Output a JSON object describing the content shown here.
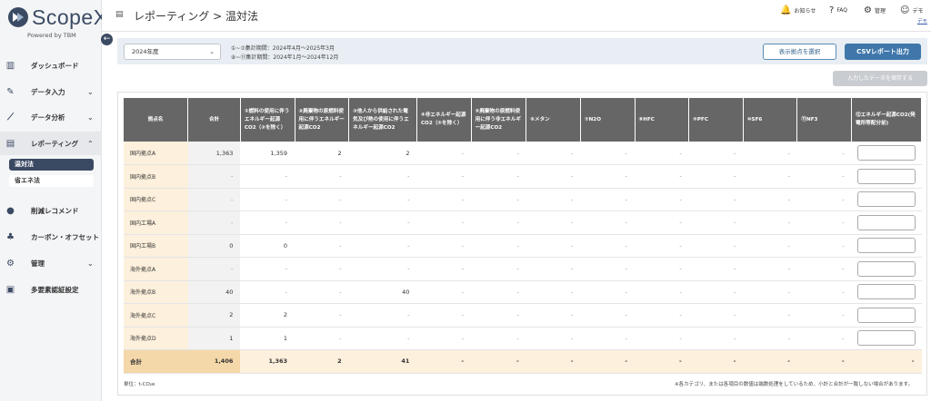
{
  "app": {
    "logo_text": "ScopeX",
    "powered_by": "Powered by TBM",
    "collapse_icon": "←"
  },
  "colors": {
    "brand": "#3b4a63",
    "accent": "#3f77ab",
    "highlight": "#fdf0dc",
    "total_highlight": "#f5d8a9"
  },
  "sidebar": {
    "items": [
      {
        "label": "ダッシュボード",
        "icon": "dashboard-icon",
        "glyph": "▥",
        "chevron": ""
      },
      {
        "label": "データ入力",
        "icon": "pen-icon",
        "glyph": "✎",
        "chevron": "⌄"
      },
      {
        "label": "データ分析",
        "icon": "chart-icon",
        "glyph": "⟋",
        "chevron": "⌄"
      },
      {
        "label": "レポーティング",
        "icon": "document-icon",
        "glyph": "▤",
        "chevron": "⌃"
      },
      {
        "label": "削減レコメンド",
        "icon": "bulb-icon",
        "glyph": "●",
        "chevron": ""
      },
      {
        "label": "カーボン・オフセット",
        "icon": "plant-icon",
        "glyph": "♣",
        "chevron": ""
      },
      {
        "label": "管理",
        "icon": "gear-icon",
        "glyph": "⚙",
        "chevron": "⌄"
      },
      {
        "label": "多要素認証設定",
        "icon": "lock-icon",
        "glyph": "▣",
        "chevron": ""
      }
    ],
    "sub_items": [
      {
        "label": "温対法"
      },
      {
        "label": "省エネ法"
      }
    ]
  },
  "header": {
    "page_icon": "▤",
    "breadcrumb": "レポーティング > 温対法",
    "links": [
      {
        "label": "お知らせ",
        "glyph": "🔔"
      },
      {
        "label": "FAQ",
        "glyph": "?"
      },
      {
        "label": "管理",
        "glyph": "⚙"
      },
      {
        "label": "デモ",
        "glyph": "☺"
      }
    ],
    "user_sub": "デモ"
  },
  "filter": {
    "year_value": "2024年度",
    "select_arrow": "⌄",
    "period_lines": [
      "①~⑦集計期間：2024年4月～2025年3月",
      "⑧~⑪集計期間：2024年1月～2024年12月"
    ],
    "select_sites_label": "表示拠点を選択",
    "csv_label": "CSVレポート出力",
    "save_label": "入力したデータを保存する"
  },
  "table": {
    "headers": [
      "拠点名",
      "合計",
      "①燃料の使用に伴うエネルギー起源CO2（②を除く）",
      "②廃棄物の原燃料使用に伴うエネルギー起源CO2",
      "③他人から供給された電気及び熱の使用に伴うエネルギー起源CO2",
      "④非エネルギー起源CO2（⑤を除く）",
      "⑤廃棄物の原燃料使用に伴う非エネルギー起源CO2",
      "⑥メタン",
      "⑦N2O",
      "⑧HFC",
      "⑨PFC",
      "⑩SF6",
      "⑪NF3",
      "⑫エネルギー起源CO2(発電所等配分前)"
    ],
    "rows": [
      {
        "name": "国内拠点A",
        "cells": [
          "1,363",
          "1,359",
          "2",
          "2",
          "-",
          "-",
          "-",
          "-",
          "-",
          "-",
          "-",
          "-"
        ]
      },
      {
        "name": "国内拠点B",
        "cells": [
          "-",
          "-",
          "-",
          "-",
          "-",
          "-",
          "-",
          "-",
          "-",
          "-",
          "-",
          "-"
        ]
      },
      {
        "name": "国内拠点C",
        "cells": [
          "-",
          "-",
          "-",
          "-",
          "-",
          "-",
          "-",
          "-",
          "-",
          "-",
          "-",
          "-"
        ]
      },
      {
        "name": "国内工場A",
        "cells": [
          "-",
          "-",
          "-",
          "-",
          "-",
          "-",
          "-",
          "-",
          "-",
          "-",
          "-",
          "-"
        ]
      },
      {
        "name": "国内工場B",
        "cells": [
          "0",
          "0",
          "-",
          "-",
          "-",
          "-",
          "-",
          "-",
          "-",
          "-",
          "-",
          "-"
        ]
      },
      {
        "name": "海外拠点A",
        "cells": [
          "-",
          "-",
          "-",
          "-",
          "-",
          "-",
          "-",
          "-",
          "-",
          "-",
          "-",
          "-"
        ]
      },
      {
        "name": "海外拠点B",
        "cells": [
          "40",
          "-",
          "-",
          "40",
          "-",
          "-",
          "-",
          "-",
          "-",
          "-",
          "-",
          "-"
        ]
      },
      {
        "name": "海外拠点C",
        "cells": [
          "2",
          "2",
          "-",
          "-",
          "-",
          "-",
          "-",
          "-",
          "-",
          "-",
          "-",
          "-"
        ]
      },
      {
        "name": "海外拠点D",
        "cells": [
          "1",
          "1",
          "-",
          "-",
          "-",
          "-",
          "-",
          "-",
          "-",
          "-",
          "-",
          "-"
        ]
      }
    ],
    "total": {
      "name": "合計",
      "cells": [
        "1,406",
        "1,363",
        "2",
        "41",
        "-",
        "-",
        "-",
        "-",
        "-",
        "-",
        "-",
        "-",
        "-"
      ]
    },
    "unit": "単位：t-CO₂e",
    "note": "※各カテゴリ、または各項目の数値は端数処理をしているため、小計と合計が一致しない場合があります。"
  }
}
